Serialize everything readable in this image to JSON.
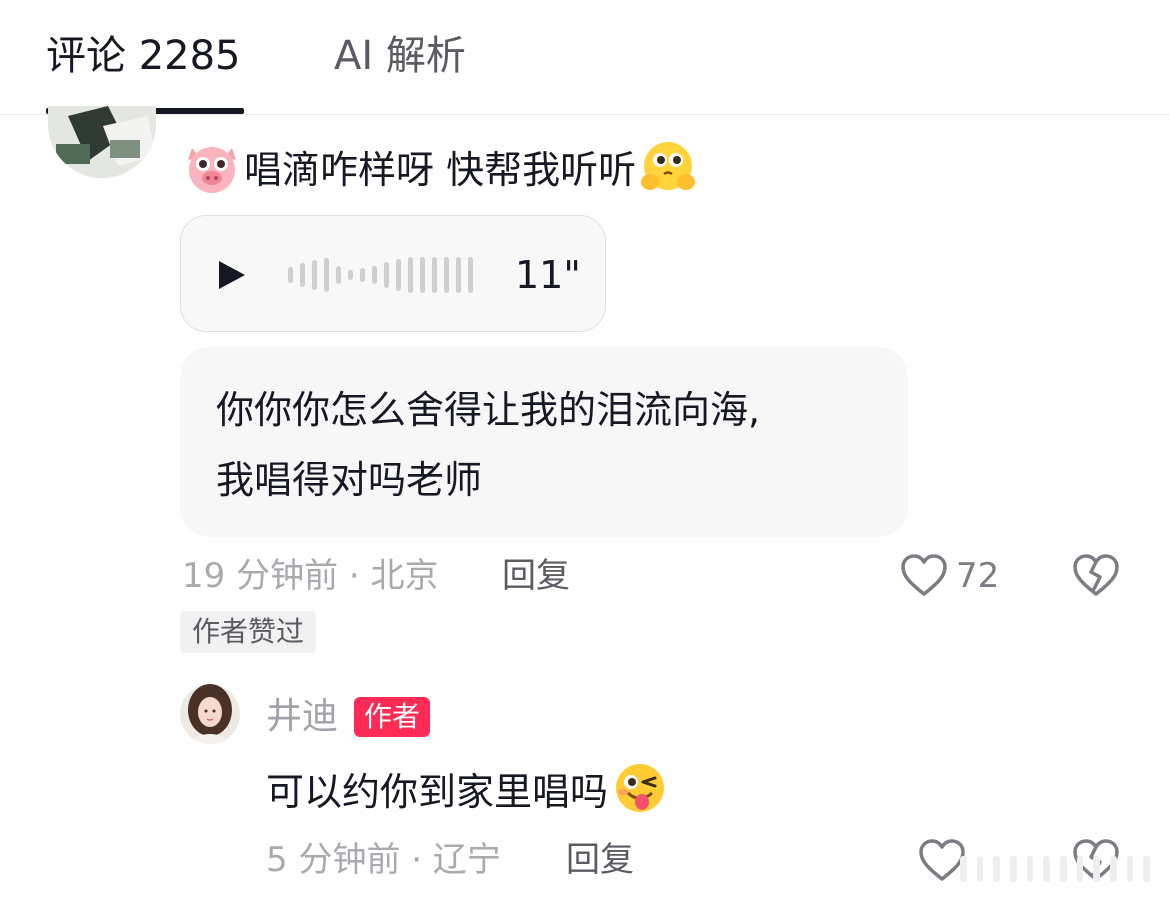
{
  "tabs": [
    {
      "label": "评论 2285",
      "active": true
    },
    {
      "label": "AI 解析",
      "active": false
    }
  ],
  "comment": {
    "text": "唱滴咋样呀 快帮我听听",
    "emoji_leading": "pig-face-icon",
    "emoji_trailing": "hands-over-cheeks-icon",
    "voice": {
      "duration": "11\"",
      "icon": "play-icon"
    },
    "bubble_lines": [
      "你你你怎么舍得让我的泪流向海,",
      "我唱得对吗老师"
    ],
    "time": "19 分钟前 · 北京",
    "reply_label": "回复",
    "like_count": "72",
    "author_liked_badge": "作者赞过"
  },
  "reply": {
    "name": "井迪",
    "author_badge": "作者",
    "text": "可以约你到家里唱吗",
    "emoji_trailing": "winking-tongue-face-icon",
    "time": "5 分钟前 · 辽宁",
    "reply_label": "回复"
  },
  "colors": {
    "accent": "#fe2c55",
    "text_primary": "#161823",
    "text_secondary": "#a9aab0",
    "bubble_bg": "#f7f7f7"
  }
}
